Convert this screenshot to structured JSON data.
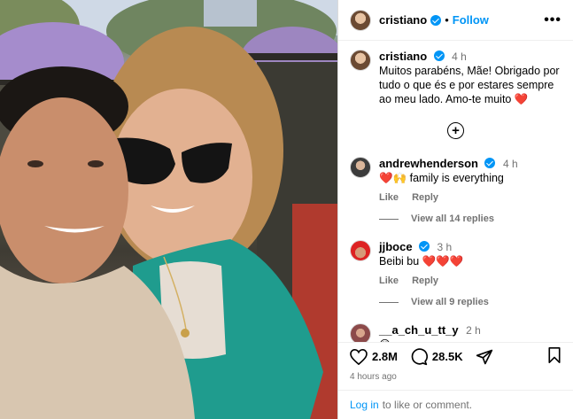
{
  "header": {
    "username": "cristiano",
    "follow_label": "Follow",
    "more_label": "•••"
  },
  "caption": {
    "username": "cristiano",
    "time": "4 h",
    "text": "Muitos parabéns, Mãe! Obrigado por tudo o que és e por estares sempre ao meu lado. Amo-te muito",
    "emoji": "❤️"
  },
  "comments": [
    {
      "username": "andrewhenderson",
      "verified": true,
      "time": "4 h",
      "text": "❤️🙌 family is everything",
      "like": "Like",
      "reply": "Reply",
      "view_all": "View all 14 replies"
    },
    {
      "username": "jjboce",
      "verified": true,
      "time": "3 h",
      "text": "Beibi bu ❤️❤️❤️",
      "like": "Like",
      "reply": "Reply",
      "view_all": "View all 9 replies"
    },
    {
      "username": "__a_ch_u_tt_y",
      "verified": false,
      "time": "2 h",
      "text": "😍"
    }
  ],
  "actions": {
    "likes": "2.8M",
    "comments": "28.5K"
  },
  "posted": "4 hours ago",
  "login": {
    "link": "Log in",
    "text": "to like or comment."
  }
}
